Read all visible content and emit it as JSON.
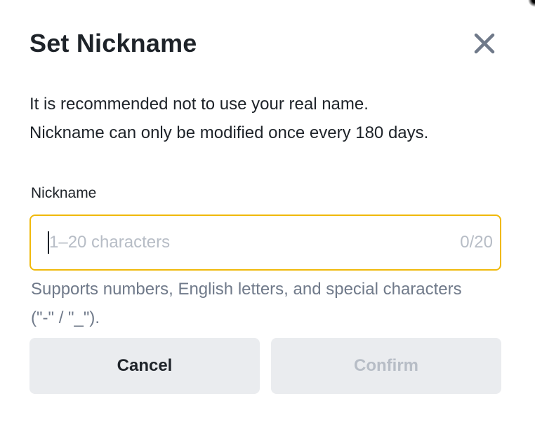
{
  "dialog": {
    "title": "Set Nickname",
    "close_icon": "close-icon",
    "description_lines": [
      "It is recommended not to use your real name.",
      "Nickname can only be modified once every 180 days."
    ]
  },
  "nickname_field": {
    "label": "Nickname",
    "value": "",
    "placeholder": "1–20 characters",
    "counter": "0/20",
    "hint": "Supports numbers, English letters, and special characters (\"-\" / \"_\")."
  },
  "actions": {
    "cancel_label": "Cancel",
    "confirm_label": "Confirm"
  },
  "colors": {
    "accent": "#f0b90b",
    "text_primary": "#1e2329",
    "text_secondary": "#707a8a",
    "text_disabled": "#b7bdc6",
    "button_bg": "#eaecef"
  }
}
